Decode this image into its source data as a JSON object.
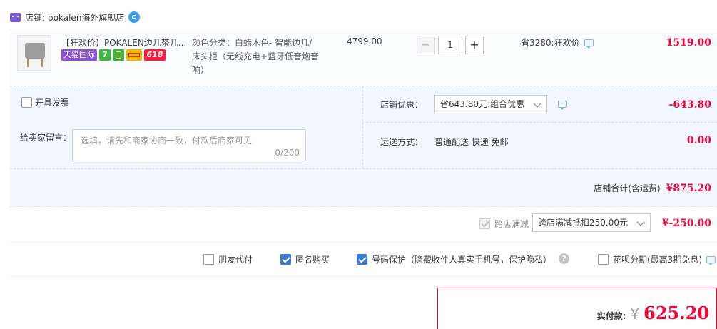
{
  "store": {
    "label": "店铺:",
    "name": "pokalen海外旗舰店"
  },
  "item": {
    "title": "【狂欢价】POKALEN边几茶几...",
    "badges": {
      "tmall_intl": "天猫国际",
      "seven": "7",
      "sale": "618"
    },
    "attr_line1": "颜色分类：白蜡木色- 智能边几/",
    "attr_line2": "床头柜（无线充电+蓝牙低音炮音",
    "attr_line3": "响）",
    "unit_price": "4799.00",
    "quantity": "1",
    "minus_label": "−",
    "plus_label": "+",
    "discount_text": "省3280:狂欢价",
    "subtotal": "1519.00"
  },
  "invoice": {
    "label": "开具发票"
  },
  "message": {
    "label": "给卖家留言：",
    "placeholder": "选填，请先和商家协商一致，付款后商家可见",
    "counter": "0/200"
  },
  "store_discount": {
    "label": "店铺优惠：",
    "selected": "省643.80元:组合优惠",
    "amount": "-643.80"
  },
  "shipping": {
    "label": "运送方式：",
    "method": "普通配送 快递 免邮",
    "amount": "0.00"
  },
  "store_total": {
    "label": "店铺合计(含运费)",
    "amount": "¥875.20"
  },
  "cross_store": {
    "label": "跨店满减",
    "selected": "跨店满减抵扣250.00元",
    "amount": "¥-250.00"
  },
  "options": {
    "friend_pay": "朋友代付",
    "anonymous": "匿名购买",
    "number_protect": "号码保护（隐藏收件人真实手机号，保护隐私）",
    "huabei": "花呗分期(最高3期免息)"
  },
  "payment": {
    "label": "实付款:",
    "currency": "¥",
    "amount": "625.20"
  },
  "colors": {
    "accent_red": "#ff0036",
    "panel_blue": "#f2f7ff",
    "checkbox_blue": "#3a7bd5"
  }
}
